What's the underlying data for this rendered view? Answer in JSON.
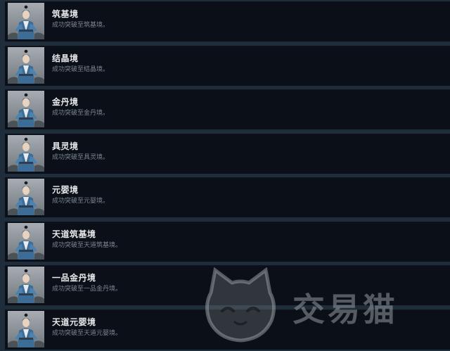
{
  "achievements": [
    {
      "title": "筑基境",
      "description": "成功突破至筑基境。"
    },
    {
      "title": "结晶境",
      "description": "成功突破至结晶境。"
    },
    {
      "title": "金丹境",
      "description": "成功突破至金丹境。"
    },
    {
      "title": "具灵境",
      "description": "成功突破至具灵境。"
    },
    {
      "title": "元婴境",
      "description": "成功突破至元婴境。"
    },
    {
      "title": "天道筑基境",
      "description": "成功突破至天道筑基境。"
    },
    {
      "title": "一品金丹境",
      "description": "成功突破至一品金丹境。"
    },
    {
      "title": "天道元婴境",
      "description": "成功突破至天道元婴境。"
    }
  ],
  "watermark": {
    "text": "交易猫"
  },
  "colors": {
    "row_bg": "#0b0f18",
    "separator": "#1f2d3b",
    "title": "#e6e8ea",
    "description": "#7b8591"
  }
}
